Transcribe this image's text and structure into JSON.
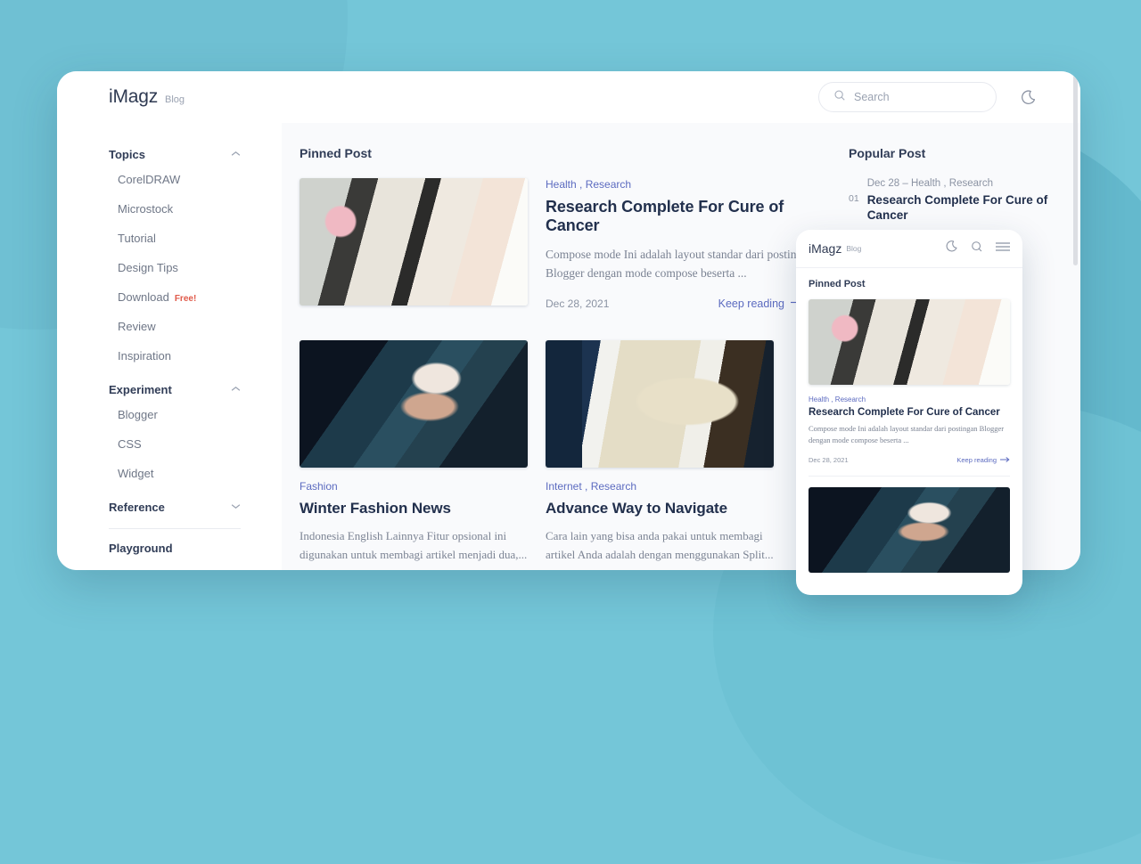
{
  "header": {
    "brand": "iMagz",
    "brand_sub": "Blog",
    "search_placeholder": "Search",
    "search_value": "",
    "search_icon": "search-icon",
    "theme_icon": "moon-icon"
  },
  "sidebar": {
    "groups": [
      {
        "title": "Topics",
        "chevron": "chevron-up",
        "items": [
          {
            "label": "CorelDRAW"
          },
          {
            "label": "Microstock"
          },
          {
            "label": "Tutorial"
          },
          {
            "label": "Design Tips"
          },
          {
            "label": "Download",
            "badge": "Free!"
          },
          {
            "label": "Review"
          },
          {
            "label": "Inspiration"
          }
        ]
      },
      {
        "title": "Experiment",
        "chevron": "chevron-up",
        "items": [
          {
            "label": "Blogger"
          },
          {
            "label": "CSS"
          },
          {
            "label": "Widget"
          }
        ]
      },
      {
        "title": "Reference",
        "chevron": "chevron-down",
        "items": []
      },
      {
        "title": "Playground",
        "chevron": "",
        "items": []
      }
    ]
  },
  "main": {
    "section_title": "Pinned Post",
    "pinned": {
      "image": "lab-technician-photo",
      "cats": "Health , Research",
      "title": "Research Complete For Cure of Cancer",
      "excerpt": "Compose mode Ini adalah layout standar dari postingan Blogger dengan mode compose beserta ...",
      "date": "Dec 28, 2021",
      "keep_reading": "Keep reading",
      "arrow": "arrow-right-icon"
    },
    "cards": [
      {
        "image": "winter-woman-photo",
        "cats": "Fashion",
        "title": "Winter Fashion News",
        "excerpt": "Indonesia English Lainnya Fitur opsional ini digunakan untuk membagi artikel menjadi dua,..."
      },
      {
        "image": "tablet-map-photo",
        "cats": "Internet , Research",
        "title": "Advance Way to Navigate",
        "excerpt": "Cara lain yang bisa anda pakai untuk membagi artikel Anda adalah dengan menggunakan Split..."
      }
    ]
  },
  "popular": {
    "section_title": "Popular Post",
    "items": [
      {
        "num": "01",
        "date": "Dec 28",
        "sep": "–",
        "cats": "Health , Research",
        "title": "Research Complete For Cure of Cancer"
      }
    ]
  },
  "mobile": {
    "brand": "iMagz",
    "brand_sub": "Blog",
    "icons": [
      "moon-icon",
      "search-icon",
      "hamburger-icon"
    ],
    "section_title": "Pinned Post",
    "post": {
      "image": "lab-technician-photo",
      "cats": "Health , Research",
      "title": "Research Complete For Cure of Cancer",
      "excerpt": "Compose mode Ini adalah layout standar dari postingan Blogger dengan mode compose beserta ...",
      "date": "Dec 28, 2021",
      "keep_reading": "Keep reading",
      "arrow": "arrow-right-icon"
    },
    "next_image": "winter-woman-photo"
  },
  "colors": {
    "background": "#74c6d8",
    "accent_link": "#5c6bc0",
    "heading": "#22304d",
    "badge_free": "#e05a4a",
    "panel": "#f9fafc"
  }
}
